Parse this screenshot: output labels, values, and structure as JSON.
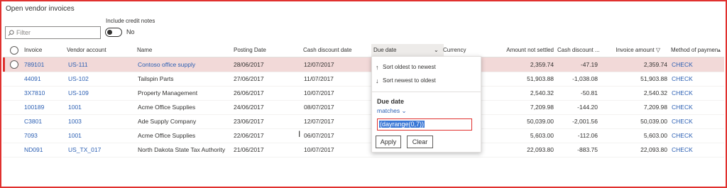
{
  "page": {
    "title": "Open vendor invoices"
  },
  "filter": {
    "placeholder": "Filter"
  },
  "credit_notes": {
    "label": "Include credit notes",
    "value": "No",
    "on": false
  },
  "columns": {
    "invoice": "Invoice",
    "vendor_account": "Vendor account",
    "name": "Name",
    "posting_date": "Posting Date",
    "cash_discount_date": "Cash discount date",
    "due_date": "Due date",
    "currency": "Currency",
    "amount_not_settled": "Amount not settled",
    "cash_discount": "Cash discount ...",
    "invoice_amount": "Invoice amount",
    "method_of_payment": "Method of payment"
  },
  "rows": [
    {
      "invoice": "789101",
      "vendor_account": "US-111",
      "name": "Contoso office supply",
      "posting_date": "28/06/2017",
      "cash_discount_date": "12/07/2017",
      "amount_not_settled": "2,359.74",
      "cash_discount": "-47.19",
      "invoice_amount": "2,359.74",
      "method": "CHECK"
    },
    {
      "invoice": "44091",
      "vendor_account": "US-102",
      "name": "Tailspin Parts",
      "posting_date": "27/06/2017",
      "cash_discount_date": "11/07/2017",
      "amount_not_settled": "51,903.88",
      "cash_discount": "-1,038.08",
      "invoice_amount": "51,903.88",
      "method": "CHECK"
    },
    {
      "invoice": "3X7810",
      "vendor_account": "US-109",
      "name": "Property Management",
      "posting_date": "26/06/2017",
      "cash_discount_date": "10/07/2017",
      "amount_not_settled": "2,540.32",
      "cash_discount": "-50.81",
      "invoice_amount": "2,540.32",
      "method": "CHECK"
    },
    {
      "invoice": "100189",
      "vendor_account": "1001",
      "name": "Acme Office Supplies",
      "posting_date": "24/06/2017",
      "cash_discount_date": "08/07/2017",
      "amount_not_settled": "7,209.98",
      "cash_discount": "-144.20",
      "invoice_amount": "7,209.98",
      "method": "CHECK"
    },
    {
      "invoice": "C3801",
      "vendor_account": "1003",
      "name": "Ade Supply Company",
      "posting_date": "23/06/2017",
      "cash_discount_date": "12/07/2017",
      "amount_not_settled": "50,039.00",
      "cash_discount": "-2,001.56",
      "invoice_amount": "50,039.00",
      "method": "CHECK"
    },
    {
      "invoice": "7093",
      "vendor_account": "1001",
      "name": "Acme Office Supplies",
      "posting_date": "22/06/2017",
      "cash_discount_date": "06/07/2017",
      "amount_not_settled": "5,603.00",
      "cash_discount": "-112.06",
      "invoice_amount": "5,603.00",
      "method": "CHECK"
    },
    {
      "invoice": "ND091",
      "vendor_account": "US_TX_017",
      "name": "North Dakota State Tax Authority",
      "posting_date": "21/06/2017",
      "cash_discount_date": "10/07/2017",
      "amount_not_settled": "22,093.80",
      "cash_discount": "-883.75",
      "invoice_amount": "22,093.80",
      "method": "CHECK"
    }
  ],
  "dropdown": {
    "sort_asc": "Sort oldest to newest",
    "sort_desc": "Sort newest to oldest",
    "filter_title": "Due date",
    "operator": "matches",
    "value": "(dayrange(0,7))",
    "apply": "Apply",
    "clear": "Clear"
  },
  "colors": {
    "accent": "#2b5fb3",
    "selected_row": "#f2d9d8",
    "highlight_border": "#e0312f"
  }
}
